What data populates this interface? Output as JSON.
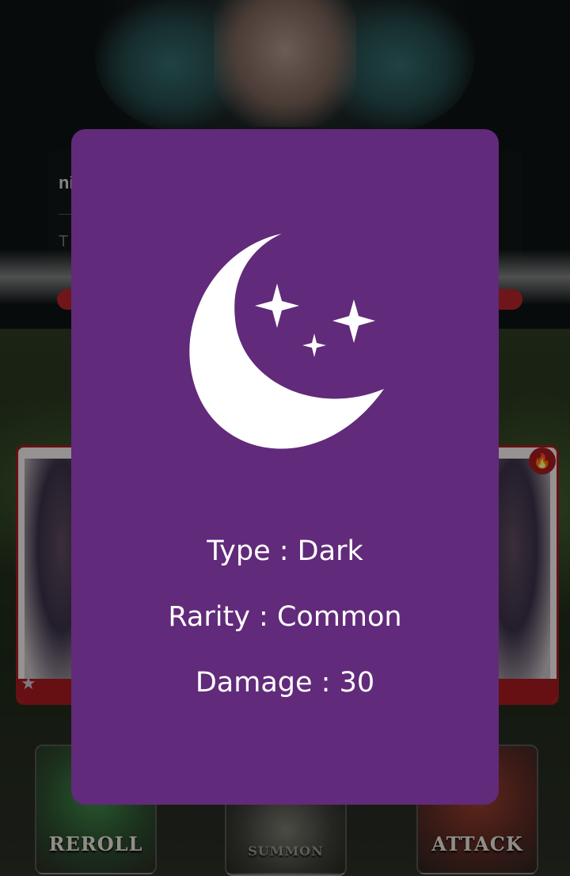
{
  "background": {
    "chat": {
      "name": "ni",
      "text": "T"
    },
    "buttons": [
      {
        "id": "reroll",
        "label": "REROLL"
      },
      {
        "id": "summon",
        "label": "SUMMON"
      },
      {
        "id": "attack",
        "label": "ATTACK"
      }
    ]
  },
  "card": {
    "icon": "moon-stars-icon",
    "background_color": "#612a7a",
    "type_label": "Type : Dark",
    "rarity_label": "Rarity : Common",
    "damage_label": "Damage : 30"
  }
}
